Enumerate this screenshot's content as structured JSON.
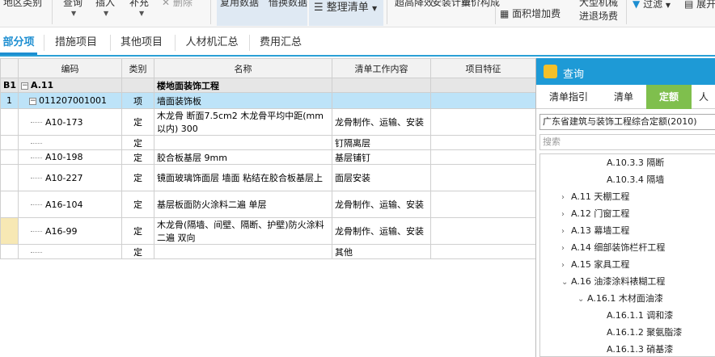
{
  "ribbon": {
    "items": [
      "地区类别",
      "查询",
      "插入",
      "补充",
      "删除",
      "复用数据",
      "借换数据",
      "整理清单",
      "超高降效",
      "安装计费",
      "单价构成",
      "面积增加费",
      "大型机械",
      "进退场费",
      "过滤",
      "展开"
    ]
  },
  "tabs": [
    {
      "label": "部分项"
    },
    {
      "label": "措施项目"
    },
    {
      "label": "其他项目"
    },
    {
      "label": "人材机汇总"
    },
    {
      "label": "费用汇总"
    }
  ],
  "grid": {
    "headers": {
      "no": "",
      "code": "编码",
      "type": "类别",
      "name": "名称",
      "content": "清单工作内容",
      "feature": "项目特征"
    },
    "rows": [
      {
        "no": "B1",
        "code": "A.11",
        "type": "",
        "name": "楼地面装饰工程",
        "content": "",
        "feature": ""
      },
      {
        "no": "1",
        "code": "011207001001",
        "type": "项",
        "name": "墙面装饰板",
        "content": "",
        "feature": ""
      },
      {
        "no": "",
        "code": "A10-173",
        "type": "定",
        "name": "木龙骨 断面7.5cm2 木龙骨平均中距(mm以内) 300",
        "content": "龙骨制作、运输、安装",
        "feature": ""
      },
      {
        "no": "",
        "code": "",
        "type": "定",
        "name": "",
        "content": "钉隔离层",
        "feature": ""
      },
      {
        "no": "",
        "code": "A10-198",
        "type": "定",
        "name": "胶合板基层 9mm",
        "content": "基层铺钉",
        "feature": ""
      },
      {
        "no": "",
        "code": "A10-227",
        "type": "定",
        "name": "镜面玻璃饰面层 墙面 粘结在胶合板基层上",
        "content": "面层安装",
        "feature": ""
      },
      {
        "no": "",
        "code": "A16-104",
        "type": "定",
        "name": "基层板面防火涂料二遍 单层",
        "content": "龙骨制作、运输、安装",
        "feature": ""
      },
      {
        "no": "",
        "code": "A16-99",
        "type": "定",
        "name": "木龙骨(隔墙、间壁、隔断、护壁)防火涂料二遍 双向",
        "content": "龙骨制作、运输、安装",
        "feature": ""
      },
      {
        "no": "",
        "code": "",
        "type": "定",
        "name": "",
        "content": "其他",
        "feature": ""
      }
    ]
  },
  "panel": {
    "title": "查询",
    "tabs": [
      {
        "label": "清单指引"
      },
      {
        "label": "清单"
      },
      {
        "label": "定额"
      },
      {
        "label": "人"
      }
    ],
    "select_value": "广东省建筑与装饰工程综合定额(2010)",
    "search_placeholder": "搜索",
    "tree": [
      {
        "label": "A.10.3.3 隔断"
      },
      {
        "label": "A.10.3.4 隔墙"
      },
      {
        "label": "A.11 天棚工程"
      },
      {
        "label": "A.12 门窗工程"
      },
      {
        "label": "A.13 幕墙工程"
      },
      {
        "label": "A.14 细部装饰栏杆工程"
      },
      {
        "label": "A.15 家具工程"
      },
      {
        "label": "A.16 油漆涂料裱糊工程"
      },
      {
        "label": "A.16.1 木材面油漆"
      },
      {
        "label": "A.16.1.1 调和漆"
      },
      {
        "label": "A.16.1.2 聚氨脂漆"
      },
      {
        "label": "A.16.1.3 硝基漆"
      }
    ]
  },
  "colors": {
    "accent": "#1d8ed1",
    "panel_header": "#1e9ad6",
    "active_subtab": "#7fbf4d",
    "selected_row": "#bde3f8"
  }
}
